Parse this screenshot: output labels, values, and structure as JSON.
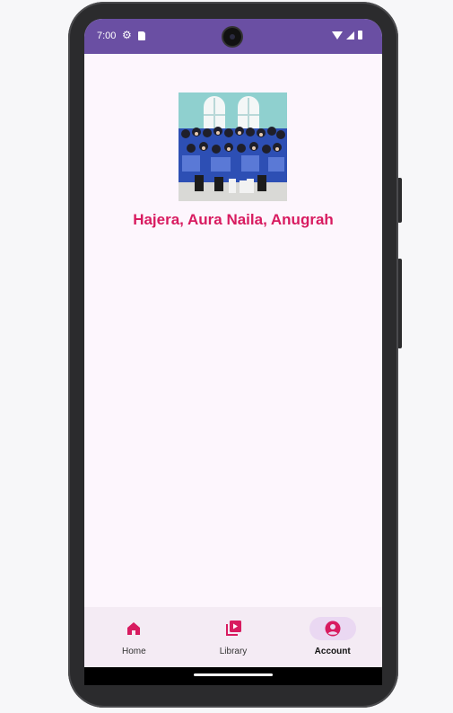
{
  "status_bar": {
    "time": "7:00",
    "icons": [
      "gear-icon",
      "sd-card-icon",
      "wifi-icon",
      "signal-icon",
      "battery-icon"
    ],
    "background_color": "#6a4fa3"
  },
  "profile": {
    "names": "Hajera, Aura Naila, Anugrah",
    "name_color": "#d81b60"
  },
  "bottom_nav": {
    "items": [
      {
        "label": "Home",
        "icon": "home-icon"
      },
      {
        "label": "Library",
        "icon": "video-library-icon"
      },
      {
        "label": "Account",
        "icon": "account-circle-icon"
      }
    ],
    "active": "Account",
    "accent_color": "#d81b60"
  }
}
